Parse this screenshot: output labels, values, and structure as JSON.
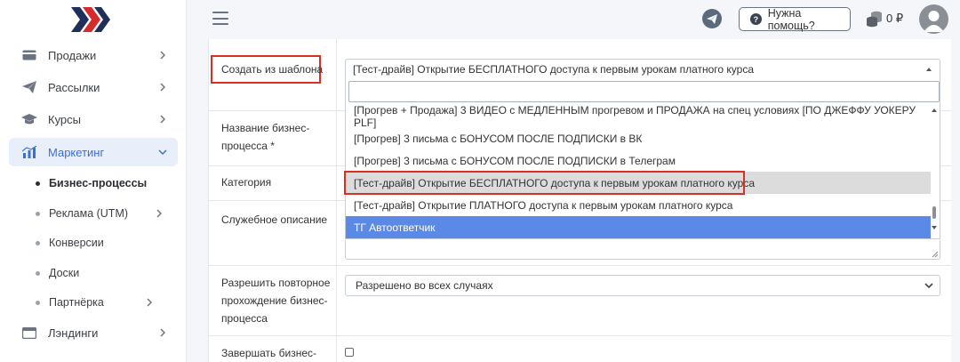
{
  "sidebar": {
    "items": [
      {
        "label": "Продажи",
        "icon": "card-icon"
      },
      {
        "label": "Рассылки",
        "icon": "send-icon"
      },
      {
        "label": "Курсы",
        "icon": "graduation-icon"
      },
      {
        "label": "Маркетинг",
        "icon": "chart-icon"
      },
      {
        "label": "Лэндинги",
        "icon": "window-icon"
      }
    ],
    "sub_items": [
      {
        "label": "Бизнес-процессы"
      },
      {
        "label": "Реклама (UTM)"
      },
      {
        "label": "Конверсии"
      },
      {
        "label": "Доски"
      },
      {
        "label": "Партнёрка"
      }
    ]
  },
  "header": {
    "help_label": "Нужна помощь?",
    "balance": "0 ₽"
  },
  "form": {
    "template_label": "Создать из шаблона",
    "name_label": "Название бизнес-процесса *",
    "category_label": "Категория",
    "desc_label": "Служебное описание",
    "repeat_label": "Разрешить повторное прохождение бизнес-процесса",
    "finish_label": "Завершать бизнес-",
    "template_value": "[Тест-драйв] Открытие БЕСПЛАТНОГО доступа к первым урокам платного курса",
    "repeat_value": "Разрешено во всех случаях",
    "search_value": ""
  },
  "dropdown": {
    "options": [
      "[Прогрев + Продажа] 3 ВИДЕО с МЕДЛЕННЫМ прогревом и ПРОДАЖА на спец условиях [ПО ДЖЕФФУ УОКЕРУ PLF]",
      "[Прогрев] 3 письма с БОНУСОМ ПОСЛЕ ПОДПИСКИ в ВК",
      "[Прогрев] 3 письма с БОНУСОМ ПОСЛЕ ПОДПИСКИ в Телеграм",
      "[Тест-драйв] Открытие БЕСПЛАТНОГО доступа к первым урокам платного курса",
      "[Тест-драйв] Открытие ПЛАТНОГО доступа к первым урокам платного курса",
      "ТГ Автоответчик"
    ]
  },
  "colors": {
    "accent": "#3a6fd8",
    "selected_option": "#5a8ae6",
    "highlight_border": "#d93025",
    "logo_red": "#d62b2b",
    "logo_navy": "#1f2f5a"
  }
}
